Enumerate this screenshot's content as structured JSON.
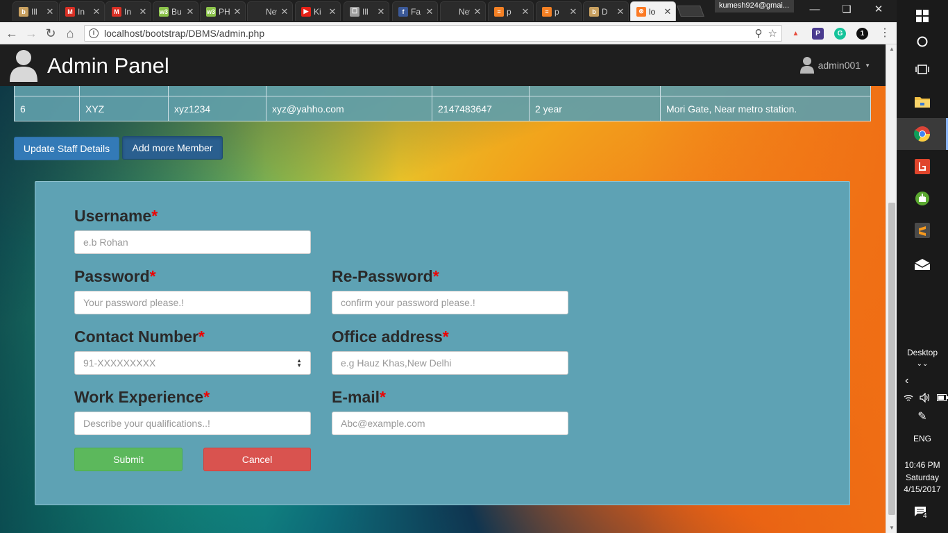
{
  "browser": {
    "tabs": [
      {
        "title": "Ill",
        "favicon": "bookpock",
        "color": "#c8a060"
      },
      {
        "title": "In",
        "favicon": "gmail",
        "color": "#d93025"
      },
      {
        "title": "In",
        "favicon": "gmail",
        "color": "#d93025"
      },
      {
        "title": "Bu",
        "favicon": "w3",
        "color": "#8bc34a"
      },
      {
        "title": "PH",
        "favicon": "w3",
        "color": "#8bc34a"
      },
      {
        "title": "New T",
        "favicon": "none",
        "color": "#777777"
      },
      {
        "title": "Ki",
        "favicon": "youtube",
        "color": "#e62117"
      },
      {
        "title": "Ill",
        "favicon": "doc",
        "color": "#9e9e9e"
      },
      {
        "title": "Fa",
        "favicon": "facebook",
        "color": "#3b5998"
      },
      {
        "title": "New T",
        "favicon": "none",
        "color": "#777777"
      },
      {
        "title": "p",
        "favicon": "stackoverflow",
        "color": "#f48024"
      },
      {
        "title": "p",
        "favicon": "stackoverflow",
        "color": "#f48024"
      },
      {
        "title": "D",
        "favicon": "bookpock",
        "color": "#c8a060"
      },
      {
        "title": "lo",
        "favicon": "xampp",
        "color": "#fb7a24",
        "active": true
      }
    ],
    "profile": "kumesh924@gmai...",
    "url": "localhost/bootstrap/DBMS/admin.php"
  },
  "navbar": {
    "title": "Admin Panel",
    "user": "admin001"
  },
  "staff_table": {
    "rows": [
      [
        "6",
        "XYZ",
        "xyz1234",
        "xyz@yahho.com",
        "2147483647",
        "2 year",
        "Mori Gate, Near metro station."
      ]
    ]
  },
  "actions": {
    "update_label": "Update Staff Details",
    "add_label": "Add more Member"
  },
  "form": {
    "username": {
      "label": "Username",
      "placeholder": "e.b Rohan"
    },
    "password": {
      "label": "Password",
      "placeholder": "Your password please.!"
    },
    "repassword": {
      "label": "Re-Password",
      "placeholder": "confirm your password please.!"
    },
    "contact": {
      "label": "Contact Number",
      "placeholder": "91-XXXXXXXXX"
    },
    "office": {
      "label": "Office address",
      "placeholder": "e.g Hauz Khas,New Delhi"
    },
    "experience": {
      "label": "Work Experience",
      "placeholder": "Describe your qualifications..!"
    },
    "email": {
      "label": "E-mail",
      "placeholder": "Abc@example.com"
    },
    "required_mark": "*",
    "submit_label": "Submit",
    "cancel_label": "Cancel"
  },
  "taskbar": {
    "desktop_label": "Desktop",
    "language": "ENG",
    "time": "10:46 PM",
    "day": "Saturday",
    "date": "4/15/2017",
    "notifications": "4"
  }
}
